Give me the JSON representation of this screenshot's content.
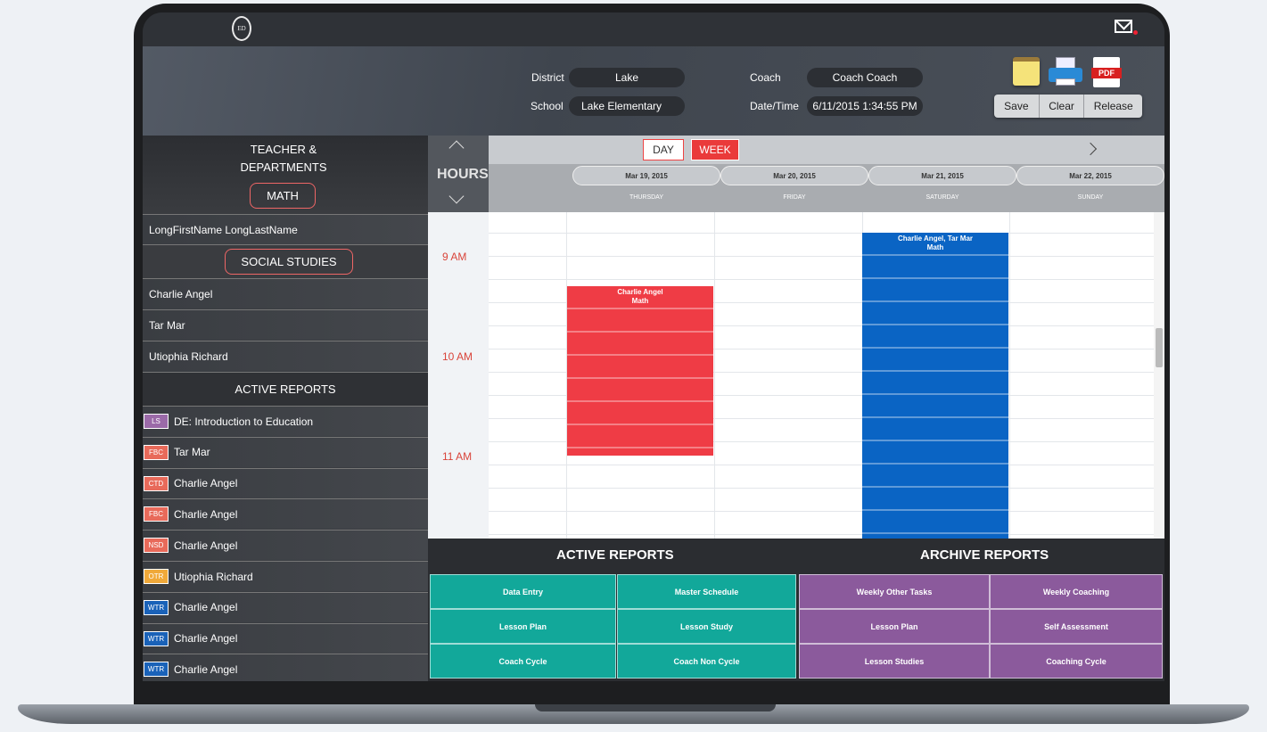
{
  "header": {
    "district_label": "District",
    "district_value": "Lake",
    "school_label": "School",
    "school_value": "Lake Elementary",
    "coach_label": "Coach",
    "coach_value": "Coach Coach",
    "datetime_label": "Date/Time",
    "datetime_value": "6/11/2015 1:34:55 PM",
    "pdf_label": "PDF",
    "save_label": "Save",
    "clear_label": "Clear",
    "release_label": "Release"
  },
  "logo_text": "ED",
  "sidebar": {
    "title": "TEACHER &\nDEPARTMENTS",
    "dept1": "MATH",
    "dept1_teachers": [
      "LongFirstName LongLastName"
    ],
    "dept2": "SOCIAL STUDIES",
    "dept2_teachers": [
      "Charlie Angel",
      "Tar Mar",
      "Utiophia Richard"
    ],
    "active_reports_title": "ACTIVE REPORTS",
    "active_reports": [
      {
        "badge": "LS",
        "color": "#9b6aa8",
        "name": "DE: Introduction to Education"
      },
      {
        "badge": "FBC",
        "color": "#e86a5a",
        "name": "Tar Mar"
      },
      {
        "badge": "CTD",
        "color": "#e86a5a",
        "name": "Charlie Angel"
      },
      {
        "badge": "FBC",
        "color": "#e86a5a",
        "name": "Charlie Angel"
      },
      {
        "badge": "NSD",
        "color": "#e86a5a",
        "name": "Charlie Angel"
      },
      {
        "badge": "OTR",
        "color": "#f0a93a",
        "name": "Utiophia Richard"
      },
      {
        "badge": "WTR",
        "color": "#1a62b8",
        "name": "Charlie Angel"
      },
      {
        "badge": "WTR",
        "color": "#1a62b8",
        "name": "Charlie Angel"
      },
      {
        "badge": "WTR",
        "color": "#1a62b8",
        "name": "Charlie Angel"
      }
    ]
  },
  "calendar": {
    "hours_label": "HOURS",
    "day_button": "DAY",
    "week_button": "WEEK",
    "dates": [
      "Mar 19, 2015",
      "Mar 20, 2015",
      "Mar 21, 2015",
      "Mar 22, 2015"
    ],
    "day_names": [
      "THURSDAY",
      "FRIDAY",
      "SATURDAY",
      "SUNDAY"
    ],
    "hours": [
      "9 AM",
      "10 AM",
      "11 AM"
    ],
    "events": [
      {
        "title": "Charlie Angel",
        "subtitle": "Math",
        "color": "#ef3c45"
      },
      {
        "title": "Charlie Angel, Tar Mar",
        "subtitle": "Math",
        "color": "#0a64c4"
      }
    ]
  },
  "reports": {
    "active_title": "ACTIVE REPORTS",
    "archive_title": "ARCHIVE REPORTS",
    "active": [
      "Data Entry",
      "Master Schedule",
      "Lesson Plan",
      "Lesson Study",
      "Coach Cycle",
      "Coach Non Cycle"
    ],
    "archive": [
      "Weekly Other Tasks",
      "Weekly Coaching",
      "Lesson Plan",
      "Self Assessment",
      "Lesson Studies",
      "Coaching Cycle"
    ]
  },
  "colors": {
    "accent_red": "#ea3a3a",
    "teal": "#12a89a",
    "purple": "#8b5a9c"
  },
  "icons": [
    "logo-icon",
    "mail-icon",
    "notepad-icon",
    "printer-icon",
    "pdf-icon",
    "chevron-up-icon",
    "chevron-down-icon",
    "chevron-right-icon"
  ]
}
